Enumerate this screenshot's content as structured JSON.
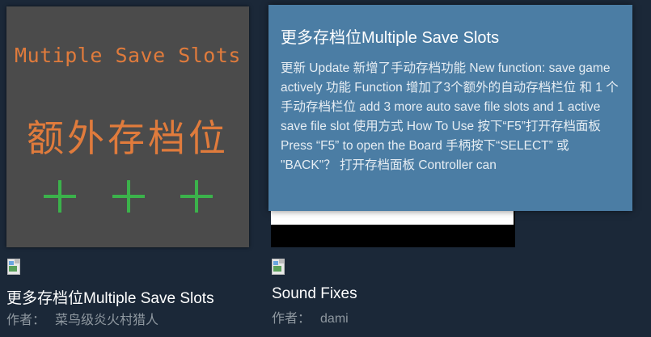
{
  "items": [
    {
      "thumbnail": {
        "title_en": "Mutiple Save Slots",
        "title_cn": "额外存档位"
      },
      "title": "更多存档位Multiple Save Slots",
      "author_label": "作者：",
      "author": "菜鸟级炎火村猎人"
    },
    {
      "title": "Sound Fixes",
      "author_label": "作者：",
      "author": "dami"
    }
  ],
  "tooltip": {
    "title": "更多存档位Multiple Save Slots",
    "description": "更新 Update 新增了手动存档功能 New function: save game actively 功能 Function 增加了3个额外的自动存档栏位 和 1 个手动存档栏位 add 3 more auto save file slots and 1 active save file slot 使用方式 How To Use 按下“F5”打开存档面板 Press “F5” to open the Board 手柄按下“SELECT” 或 \"BACK\"？ 打开存档面板 Controller can"
  },
  "colors": {
    "page_bg": "#1b2838",
    "tooltip_bg": "#4b7da4",
    "thumb_text": "#e07b3c",
    "plus_green": "#3bb24b",
    "author_gray": "#8f98a0"
  },
  "icons": [
    "broken-image-icon",
    "plus-icon"
  ]
}
